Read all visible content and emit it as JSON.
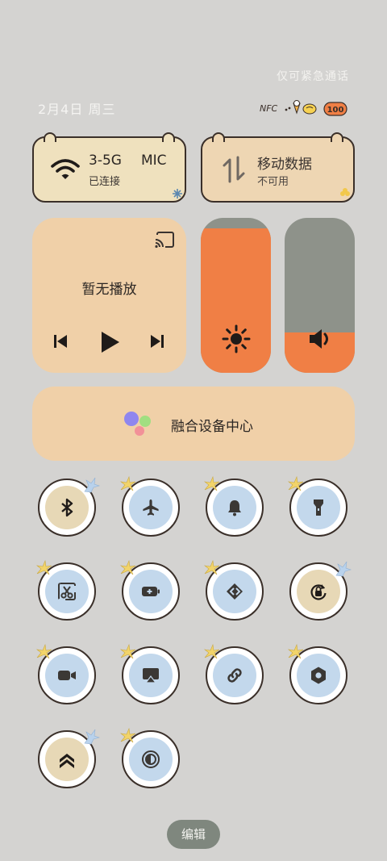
{
  "status": {
    "emergency_only": "仅可紧急通话",
    "date": "2月4日 周三"
  },
  "status_icons": {
    "nfc": "NFC",
    "battery": "100"
  },
  "wifi_tile": {
    "name": "3-5G",
    "name_tail": "MIC",
    "status": "已连接"
  },
  "data_tile": {
    "name": "移动数据",
    "status": "不可用"
  },
  "media": {
    "title": "暂无播放"
  },
  "sliders": {
    "brightness_level": 0.93,
    "volume_level": 0.26
  },
  "fusion": {
    "label": "融合设备中心"
  },
  "toggles": [
    {
      "name": "bluetooth",
      "icon": "bluetooth-icon",
      "active": true
    },
    {
      "name": "airplane",
      "icon": "airplane-icon",
      "active": false
    },
    {
      "name": "ringer",
      "icon": "bell-icon",
      "active": false
    },
    {
      "name": "flashlight",
      "icon": "flashlight-icon",
      "active": false
    },
    {
      "name": "screenshot",
      "icon": "scissors-icon",
      "active": false
    },
    {
      "name": "battery-saver",
      "icon": "battery-plus-icon",
      "active": false
    },
    {
      "name": "cast",
      "icon": "cast-arrows-icon",
      "active": false
    },
    {
      "name": "rotation-lock",
      "icon": "rotation-lock-icon",
      "active": true
    },
    {
      "name": "screen-record",
      "icon": "video-camera-icon",
      "active": false
    },
    {
      "name": "screen-mirror",
      "icon": "airplay-icon",
      "active": false
    },
    {
      "name": "link",
      "icon": "link-icon",
      "active": false
    },
    {
      "name": "settings",
      "icon": "hexagon-gear-icon",
      "active": false
    },
    {
      "name": "performance",
      "icon": "double-chevron-up-icon",
      "active": true
    },
    {
      "name": "dark-mode",
      "icon": "contrast-icon",
      "active": false
    }
  ],
  "edit": {
    "label": "编辑"
  },
  "colors": {
    "background": "#d4d3d1",
    "accent_orange": "#f07f45",
    "tile_beige": "#f0d0a8",
    "toggle_blue": "#c3d8ec"
  }
}
